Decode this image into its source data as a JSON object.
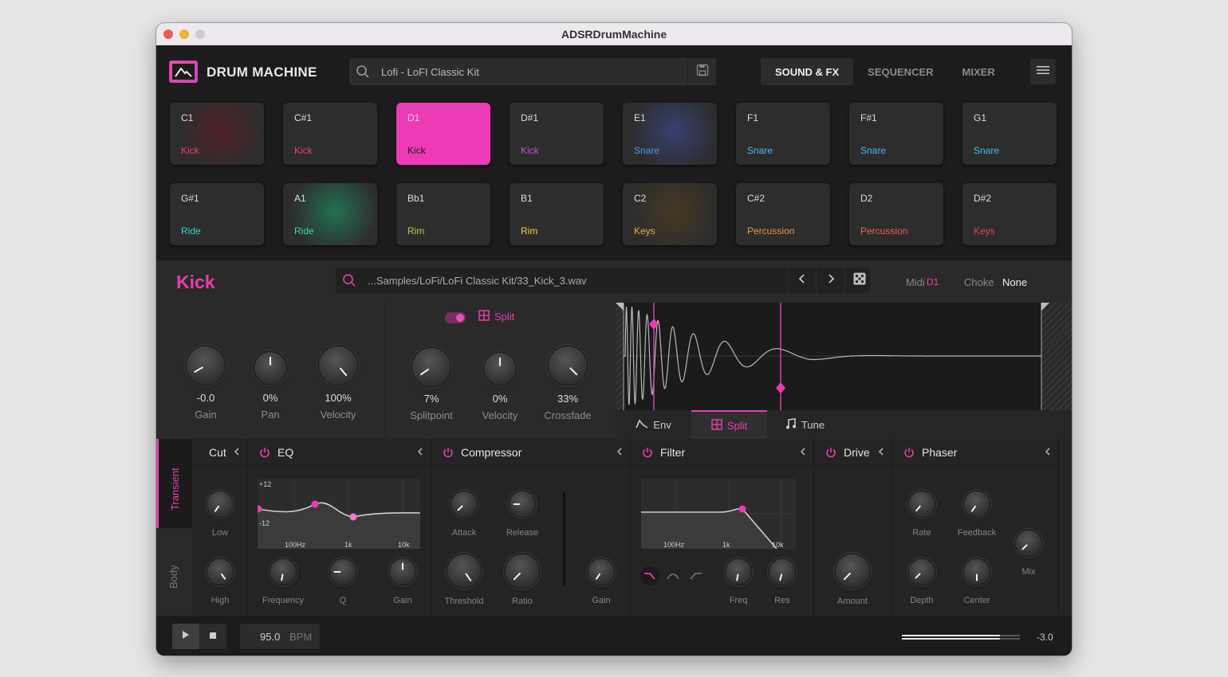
{
  "window": {
    "title": "ADSRDrumMachine"
  },
  "header": {
    "brand": "DRUM MACHINE",
    "kit_search": "Lofi - LoFI Classic Kit",
    "tabs": [
      {
        "label": "SOUND & FX",
        "active": true
      },
      {
        "label": "SEQUENCER",
        "active": false
      },
      {
        "label": "MIXER",
        "active": false
      }
    ]
  },
  "pads": [
    {
      "note": "C1",
      "name": "Kick",
      "color": "#e8437a"
    },
    {
      "note": "C#1",
      "name": "Kick",
      "color": "#e8437a"
    },
    {
      "note": "D1",
      "name": "Kick",
      "color": "#1a1a1a",
      "active": true
    },
    {
      "note": "D#1",
      "name": "Kick",
      "color": "#c44fd6"
    },
    {
      "note": "E1",
      "name": "Snare",
      "color": "#4a9ae8"
    },
    {
      "note": "F1",
      "name": "Snare",
      "color": "#4ab8ec"
    },
    {
      "note": "F#1",
      "name": "Snare",
      "color": "#4ab8ec"
    },
    {
      "note": "G1",
      "name": "Snare",
      "color": "#3ec4e4"
    },
    {
      "note": "G#1",
      "name": "Ride",
      "color": "#3cd6c6"
    },
    {
      "note": "A1",
      "name": "Ride",
      "color": "#3cd6a8"
    },
    {
      "note": "Bb1",
      "name": "Rim",
      "color": "#a8d44a"
    },
    {
      "note": "B1",
      "name": "Rim",
      "color": "#e8d44a"
    },
    {
      "note": "C2",
      "name": "Keys",
      "color": "#e8b04a"
    },
    {
      "note": "C#2",
      "name": "Percussion",
      "color": "#e8964a"
    },
    {
      "note": "D2",
      "name": "Percussion",
      "color": "#e8624a"
    },
    {
      "note": "D#2",
      "name": "Keys",
      "color": "#e8434a"
    }
  ],
  "editor": {
    "pad_title": "Kick",
    "sample_path": "...Samples/LoFi/LoFi Classic Kit/33_Kick_3.wav",
    "midi_label": "Midi",
    "midi_value": "D1",
    "choke_label": "Choke",
    "choke_value": "None",
    "split_label": "Split",
    "knobs_left": [
      {
        "label": "Gain",
        "value": "-0.0"
      },
      {
        "label": "Pan",
        "value": "0%"
      },
      {
        "label": "Velocity",
        "value": "100%"
      }
    ],
    "knobs_split": [
      {
        "label": "Splitpoint",
        "value": "7%"
      },
      {
        "label": "Velocity",
        "value": "0%"
      },
      {
        "label": "Crossfade",
        "value": "33%"
      }
    ],
    "wave_tabs": [
      {
        "label": "Env",
        "icon": "envelope-icon"
      },
      {
        "label": "Split",
        "icon": "split-icon",
        "active": true
      },
      {
        "label": "Tune",
        "icon": "music-note-icon"
      }
    ]
  },
  "fx": {
    "layers": [
      "Transient",
      "Body"
    ],
    "cut": {
      "title": "Cut",
      "knobs": [
        "Low",
        "High"
      ]
    },
    "eq": {
      "title": "EQ",
      "db_top": "+12",
      "db_bottom": "-12",
      "freqs": [
        "100Hz",
        "1k",
        "10k"
      ],
      "knobs": [
        "Frequency",
        "Q",
        "Gain"
      ]
    },
    "compressor": {
      "title": "Compressor",
      "knobs": [
        "Attack",
        "Release",
        "Threshold",
        "Ratio",
        "Gain"
      ]
    },
    "filter": {
      "title": "Filter",
      "freqs": [
        "100Hz",
        "1k",
        "10k"
      ],
      "knobs": [
        "Freq",
        "Res"
      ]
    },
    "drive": {
      "title": "Drive",
      "knobs": [
        "Amount"
      ]
    },
    "phaser": {
      "title": "Phaser",
      "knobs": [
        "Rate",
        "Feedback",
        "Depth",
        "Center",
        "Mix"
      ]
    }
  },
  "transport": {
    "bpm_value": "95.0",
    "bpm_label": "BPM",
    "volume_value": "-3.0",
    "volume_level": 0.83
  },
  "colors": {
    "accent": "#e83fa8",
    "bg": "#1f1f1f"
  }
}
